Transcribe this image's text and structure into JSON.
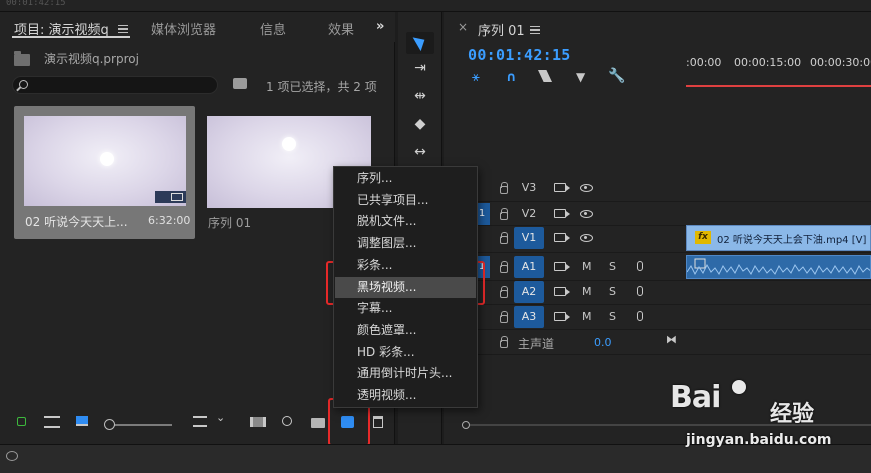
{
  "top_timecode": "00:01:42:15",
  "project_panel": {
    "tabs": [
      "项目: 演示视频q",
      "媒体浏览器",
      "信息",
      "效果"
    ],
    "overflow": "»",
    "project_file": "演示视频q.prproj",
    "search_placeholder": "",
    "selection_status": "1 项已选择，共 2 项",
    "items": [
      {
        "label": "02 听说今天天上...",
        "duration": "6:32:00",
        "selected": true
      },
      {
        "label": "序列 01",
        "duration": "",
        "selected": false
      }
    ]
  },
  "timeline": {
    "sequence_tab": "序列 01",
    "timecode": "00:01:42:15",
    "ruler_labels": [
      ":00:00",
      "00:00:15:00",
      "00:00:30:00"
    ],
    "tracks": [
      {
        "name": "V3",
        "source": "",
        "type": "video"
      },
      {
        "name": "V2",
        "source": "1",
        "type": "video"
      },
      {
        "name": "V1",
        "source": "",
        "type": "video"
      },
      {
        "name": "A1",
        "source": "1",
        "type": "audio"
      },
      {
        "name": "A2",
        "source": "",
        "type": "audio"
      },
      {
        "name": "A3",
        "source": "",
        "type": "audio"
      }
    ],
    "audio_flags": {
      "mute": "M",
      "solo": "S"
    },
    "master_label": "主声道",
    "master_value": "0.0",
    "clip_v1_label": "02 听说今天天上会下油.mp4 [V]",
    "clip_v1_fx": "fx"
  },
  "context_menu": {
    "items": [
      "序列...",
      "已共享项目...",
      "脱机文件...",
      "调整图层...",
      "彩条...",
      "黑场视频...",
      "字幕...",
      "颜色遮罩...",
      "HD 彩条...",
      "通用倒计时片头...",
      "透明视频..."
    ],
    "highlighted_index": 5
  },
  "watermark": {
    "brand_left": "Bai",
    "brand_right": "经验",
    "url": "jingyan.baidu.com"
  },
  "colors": {
    "accent_blue": "#3b9dff",
    "highlight_red": "#e82a2a",
    "track_blue": "#1d5a9c"
  }
}
